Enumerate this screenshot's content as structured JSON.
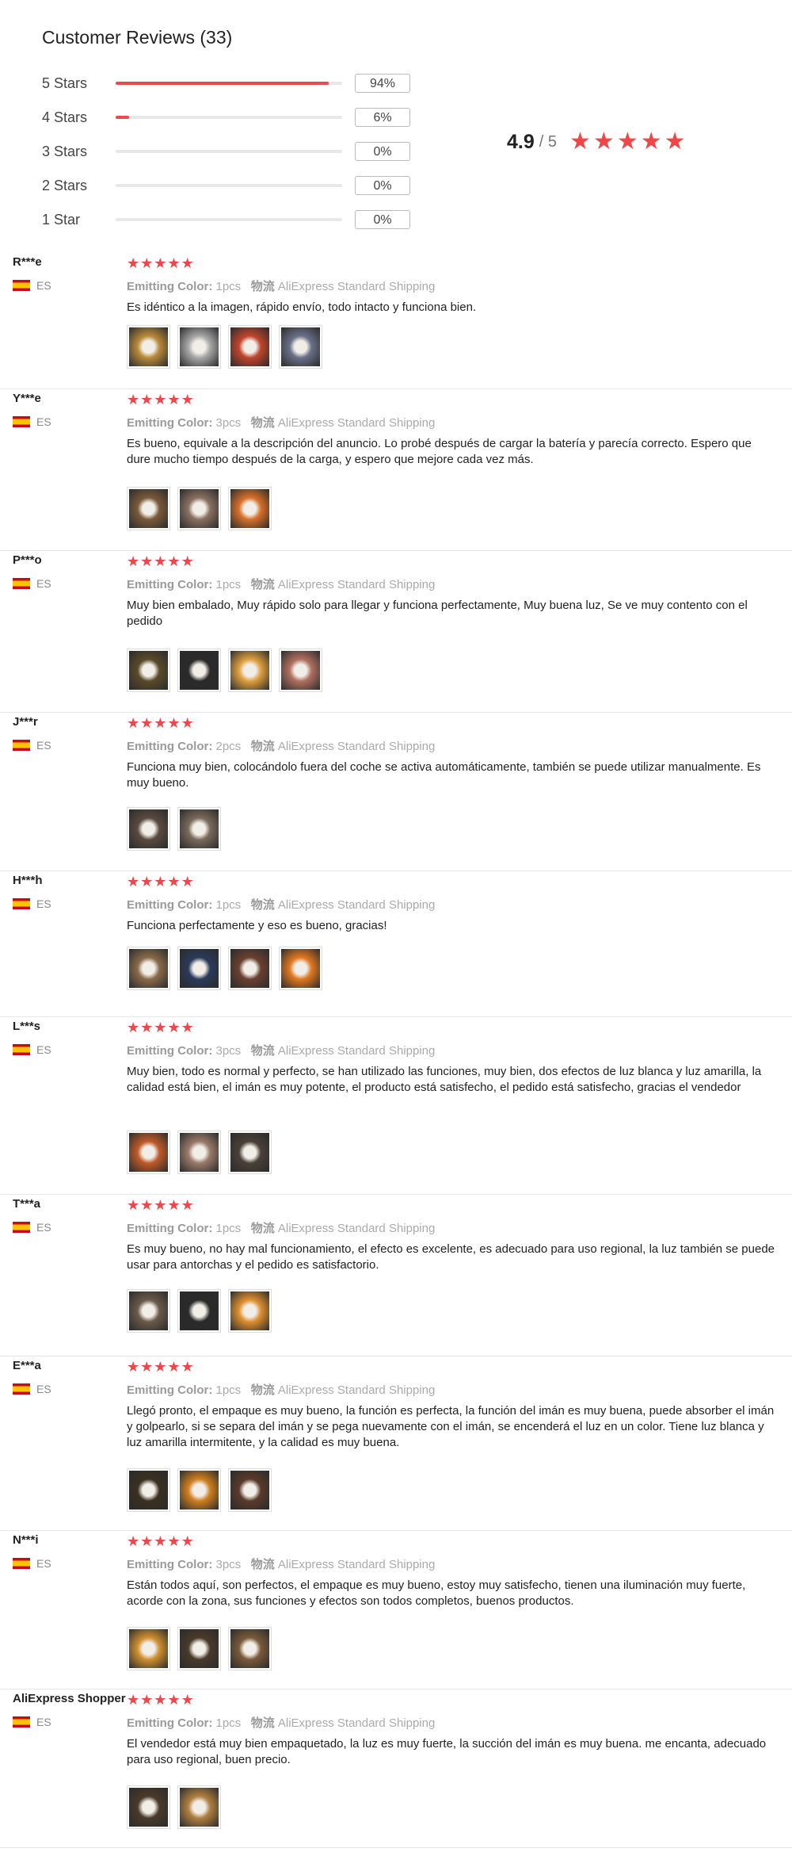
{
  "header": {
    "title": "Customer Reviews (33)"
  },
  "histogram": [
    {
      "label": "5 Stars",
      "pct": "94%",
      "fill": 0.94
    },
    {
      "label": "4 Stars",
      "pct": "6%",
      "fill": 0.06
    },
    {
      "label": "3 Stars",
      "pct": "0%",
      "fill": 0
    },
    {
      "label": "2 Stars",
      "pct": "0%",
      "fill": 0
    },
    {
      "label": "1 Star",
      "pct": "0%",
      "fill": 0
    }
  ],
  "summary": {
    "score": "4.9",
    "total": "/ 5",
    "stars": 5
  },
  "meta_labels": {
    "color_label": "Emitting Color:",
    "shipping_label": "物流"
  },
  "reviews": [
    {
      "name": "R***e",
      "country": "ES",
      "color": "1pcs",
      "shipping": "AliExpress Standard Shipping",
      "text": "Es idéntico a la imagen, rápido envío, todo intacto y funciona bien.",
      "thumbs": [
        "#b98a3a",
        "#a8a8a8",
        "#c0442c",
        "#6a7088"
      ]
    },
    {
      "name": "Y***e",
      "country": "ES",
      "color": "3pcs",
      "shipping": "AliExpress Standard Shipping",
      "text": "Es bueno, equivale a la descripción del anuncio. Lo probé después de cargar la batería y parecía correcto. Espero que dure mucho tiempo después de la carga, y espero que mejore cada vez más.",
      "thumbs": [
        "#7a5a3a",
        "#8a7060",
        "#d8702a"
      ]
    },
    {
      "name": "P***o",
      "country": "ES",
      "color": "1pcs",
      "shipping": "AliExpress Standard Shipping",
      "text": "Muy bien embalado, Muy rápido solo para llegar y funciona perfectamente, Muy buena luz, Se ve muy contento con el pedido",
      "thumbs": [
        "#5a4a2a",
        "#2a2a2a",
        "#e0a040",
        "#b07060"
      ]
    },
    {
      "name": "J***r",
      "country": "ES",
      "color": "2pcs",
      "shipping": "AliExpress Standard Shipping",
      "text": "Funciona muy bien, colocándolo fuera del coche se activa automáticamente, también se puede utilizar manualmente. Es muy bueno.",
      "thumbs": [
        "#5a4a40",
        "#7a6a5a"
      ]
    },
    {
      "name": "H***h",
      "country": "ES",
      "color": "1pcs",
      "shipping": "AliExpress Standard Shipping",
      "text": "Funciona perfectamente y eso es bueno, gracias!",
      "thumbs": [
        "#8a6a4a",
        "#2a3a5a",
        "#6a4030",
        "#e07820"
      ]
    },
    {
      "name": "L***s",
      "country": "ES",
      "color": "3pcs",
      "shipping": "AliExpress Standard Shipping",
      "text": "Muy bien, todo es normal y perfecto, se han utilizado las funciones, muy bien, dos efectos de luz blanca y luz amarilla, la calidad está bien, el imán es muy potente, el producto está satisfecho, el pedido está satisfecho, gracias el vendedor",
      "thumbs": [
        "#c05a2a",
        "#9a7a6a",
        "#4a4038"
      ]
    },
    {
      "name": "T***a",
      "country": "ES",
      "color": "1pcs",
      "shipping": "AliExpress Standard Shipping",
      "text": "Es muy bueno, no hay mal funcionamiento, el efecto es excelente, es adecuado para uso regional, la luz también se puede usar para antorchas y el pedido es satisfactorio.",
      "thumbs": [
        "#6a5a4a",
        "#2a2a2a",
        "#e09030"
      ]
    },
    {
      "name": "E***a",
      "country": "ES",
      "color": "1pcs",
      "shipping": "AliExpress Standard Shipping",
      "text": "Llegó pronto, el empaque es muy bueno, la función es perfecta, la función del imán es muy buena, puede absorber el imán y golpearlo, si se separa del imán y se pega nuevamente con el imán, se encenderá el luz en un color. Tiene luz blanca y luz amarilla intermitente, y la calidad es muy buena.",
      "thumbs": [
        "#3a3020",
        "#d08020",
        "#5a3a2a"
      ]
    },
    {
      "name": "N***i",
      "country": "ES",
      "color": "3pcs",
      "shipping": "AliExpress Standard Shipping",
      "text": "Están todos aquí, son perfectos, el empaque es muy bueno, estoy muy satisfecho, tienen una iluminación muy fuerte, acorde con la zona, sus funciones y efectos son todos completos, buenos productos.",
      "thumbs": [
        "#d09030",
        "#4a3a2a",
        "#7a5a3a"
      ]
    },
    {
      "name": "AliExpress Shopper",
      "country": "ES",
      "color": "1pcs",
      "shipping": "AliExpress Standard Shipping",
      "text": "El vendedor está muy bien empaquetado, la luz es muy fuerte, la succión del imán es muy buena. me encanta, adecuado para uso regional, buen precio.",
      "thumbs": [
        "#4a3a2a",
        "#b08040"
      ]
    }
  ]
}
